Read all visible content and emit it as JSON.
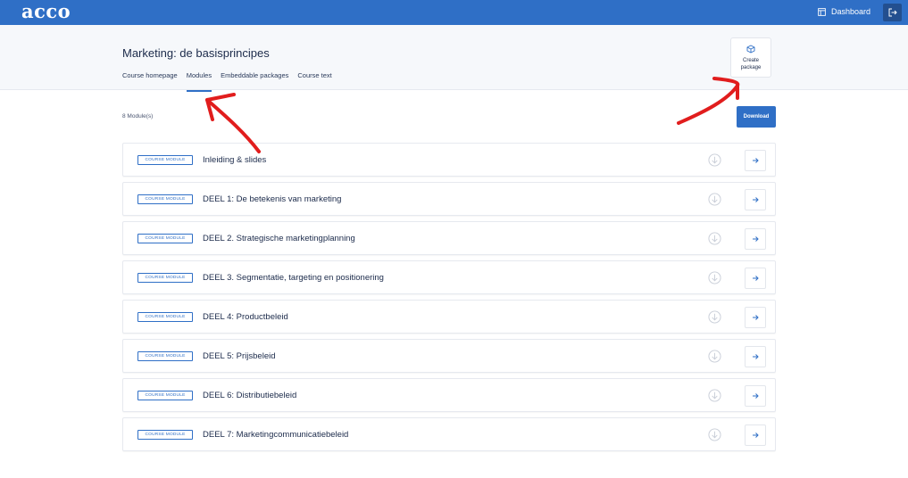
{
  "topbar": {
    "logo": "acco",
    "dashboard_label": "Dashboard"
  },
  "header": {
    "title": "Marketing: de basisprincipes",
    "tabs": [
      {
        "label": "Course homepage",
        "active": false
      },
      {
        "label": "Modules",
        "active": true
      },
      {
        "label": "Embeddable packages",
        "active": false
      },
      {
        "label": "Course text",
        "active": false
      }
    ],
    "create_package_label_1": "Create",
    "create_package_label_2": "package"
  },
  "modules": {
    "count_label": "8 Module(s)",
    "download_label": "Download",
    "items": [
      {
        "badge": "COURSE MODULE",
        "name": "Inleiding & slides"
      },
      {
        "badge": "COURSE MODULE",
        "name": "DEEL 1: De betekenis van marketing"
      },
      {
        "badge": "COURSE MODULE",
        "name": "DEEL 2. Strategische marketingplanning"
      },
      {
        "badge": "COURSE MODULE",
        "name": "DEEL 3. Segmentatie, targeting en positionering"
      },
      {
        "badge": "COURSE MODULE",
        "name": "DEEL 4: Productbeleid"
      },
      {
        "badge": "COURSE MODULE",
        "name": "DEEL 5: Prijsbeleid"
      },
      {
        "badge": "COURSE MODULE",
        "name": "DEEL 6: Distributiebeleid"
      },
      {
        "badge": "COURSE MODULE",
        "name": "DEEL 7: Marketingcommunicatiebeleid"
      }
    ]
  },
  "colors": {
    "brand": "#2f6fc6",
    "annotation": "#e11d1d"
  }
}
